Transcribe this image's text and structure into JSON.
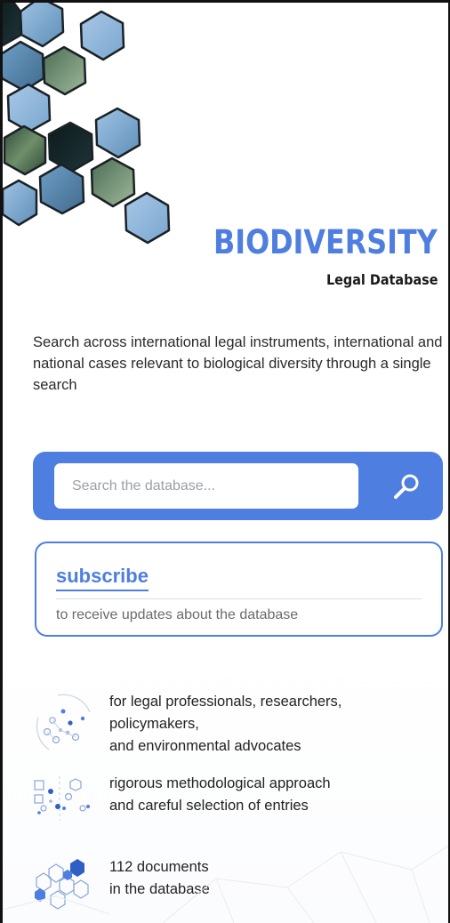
{
  "brand": {
    "title": "BIODIVERSITY",
    "subtitle": "Legal Database",
    "accent_color": "#4e7ee0"
  },
  "intro": {
    "text": "Search across international legal instruments, international and national cases relevant to biological diversity through a single search"
  },
  "search": {
    "placeholder": "Search the database...",
    "button_icon": "search-icon"
  },
  "subscribe": {
    "link_label": "subscribe",
    "description": "to receive updates about the database"
  },
  "features": [
    {
      "icon": "network-dots-icon",
      "lines": [
        "for legal professionals, researchers,",
        "policymakers,",
        "and environmental advocates"
      ]
    },
    {
      "icon": "method-dots-icon",
      "lines": [
        "rigorous methodological approach",
        "and careful selection of entries"
      ]
    },
    {
      "icon": "hexagon-cluster-icon",
      "lines": [
        "112 documents",
        "in the database"
      ]
    }
  ]
}
